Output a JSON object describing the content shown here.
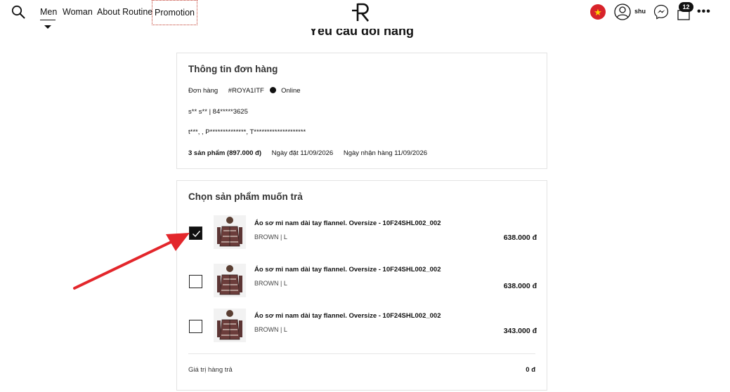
{
  "header": {
    "nav": [
      {
        "label": "Men"
      },
      {
        "label": "Woman"
      },
      {
        "label": "About Routine"
      },
      {
        "label": "Promotion"
      }
    ],
    "user_name": "shu",
    "cart_count": "12",
    "icons": [
      "search-icon",
      "logo",
      "flag-icon",
      "user-icon",
      "messenger-icon",
      "bag-icon",
      "more-icon"
    ]
  },
  "page_heading": "Yêu cầu đổi hàng",
  "order_info": {
    "title": "Thông tin đơn hàng",
    "order_label": "Đơn hàng",
    "order_code": "#ROYA1ITF",
    "channel": "Online",
    "contact": "s** s** | 84*****3625",
    "address": "t***, , P**************, T********************",
    "summary": "3 sản phẩm (897.000 đ)",
    "order_date": "Ngày đặt 11/09/2026",
    "receive_date": "Ngày nhận hàng 11/09/2026"
  },
  "products_panel": {
    "title": "Chọn sản phẩm muốn trả",
    "items": [
      {
        "name": "Áo sơ mi nam dài tay flannel. Oversize - 10F24SHL002_002",
        "variant": "BROWN | L",
        "price": "638.000 đ",
        "checked": true
      },
      {
        "name": "Áo sơ mi nam dài tay flannel. Oversize - 10F24SHL002_002",
        "variant": "BROWN | L",
        "price": "638.000 đ",
        "checked": false
      },
      {
        "name": "Áo sơ mi nam dài tay flannel. Oversize - 10F24SHL002_002",
        "variant": "BROWN | L",
        "price": "343.000 đ",
        "checked": false
      }
    ],
    "return_value_label": "Giá trị hàng trả",
    "return_value": "0 đ"
  },
  "colors": {
    "accent_arrow": "#e3262b",
    "flag_red": "#d8232a",
    "flag_star": "#ffd200"
  }
}
